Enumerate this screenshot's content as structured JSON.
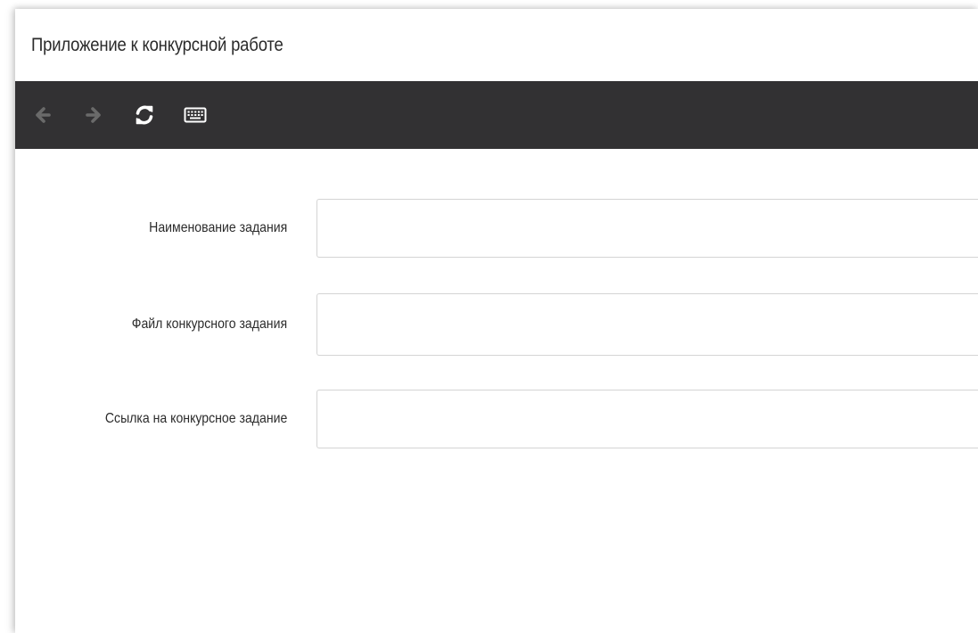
{
  "window": {
    "title": "Приложение к конкурсной работе"
  },
  "toolbar": {
    "buttons": [
      {
        "name": "back",
        "icon": "arrow-left-icon",
        "enabled": false
      },
      {
        "name": "forward",
        "icon": "arrow-right-icon",
        "enabled": false
      },
      {
        "name": "refresh",
        "icon": "refresh-icon",
        "enabled": true
      },
      {
        "name": "keyboard",
        "icon": "keyboard-icon",
        "enabled": true
      }
    ],
    "background": "#323133",
    "disabled_color": "#6a6a6a",
    "enabled_color": "#ffffff"
  },
  "form": {
    "fields": [
      {
        "label": "Наименование задания",
        "value": ""
      },
      {
        "label": "Файл конкурсного задания",
        "value": ""
      },
      {
        "label": "Ссылка на конкурсное задание",
        "value": ""
      }
    ]
  }
}
